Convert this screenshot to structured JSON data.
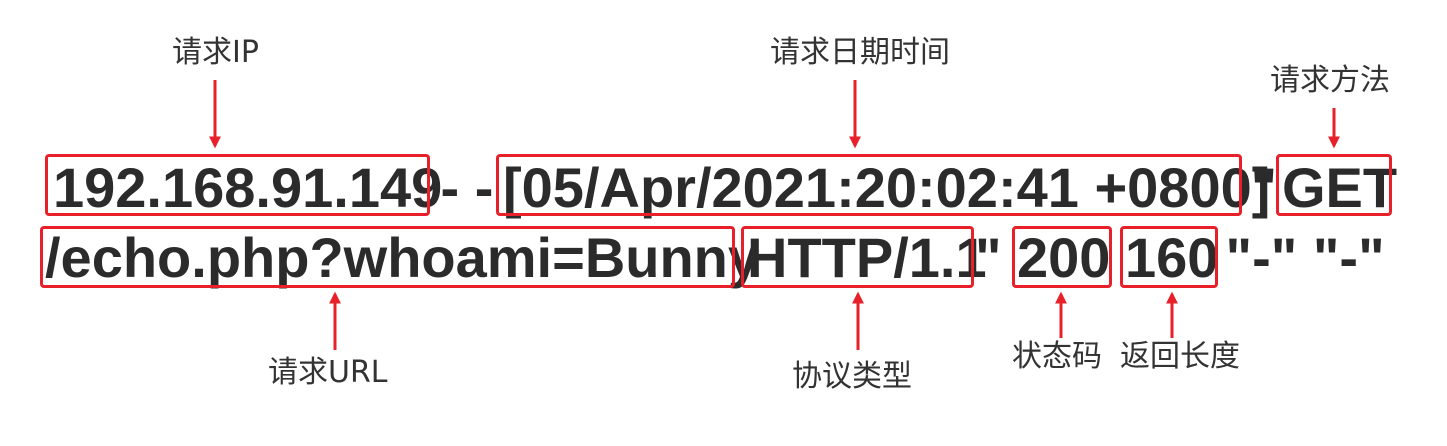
{
  "log_line": {
    "ip": "192.168.91.149",
    "dash_sep": " - - ",
    "datetime": "[05/Apr/2021:20:02:41 +0800]",
    "quote_open": " \"",
    "method": "GET",
    "url": "/echo.php?whoami=Bunny",
    "space": " ",
    "protocol": "HTTP/1.1",
    "quote_close": "\" ",
    "status": "200",
    "length": "160",
    "tail": " \"-\" \"-\""
  },
  "labels": {
    "ip": "请求IP",
    "datetime": "请求日期时间",
    "method": "请求方法",
    "url": "请求URL",
    "protocol": "协议类型",
    "status": "状态码",
    "length": "返回长度"
  },
  "colors": {
    "highlight": "#e8202a",
    "text": "#2b2b2b",
    "label": "#333333"
  }
}
